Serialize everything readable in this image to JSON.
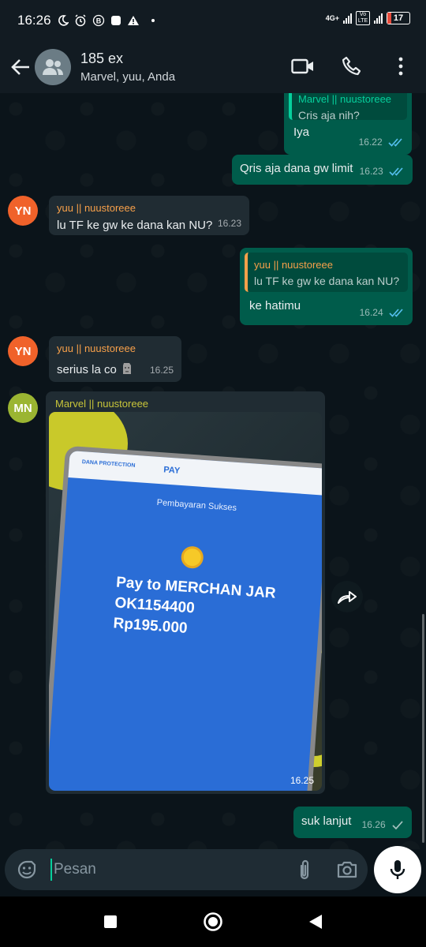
{
  "status_bar": {
    "time": "16:26",
    "network": "4G+",
    "volte": "Vo LTE",
    "battery": "17"
  },
  "header": {
    "title": "185 ex",
    "subtitle": "Marvel, yuu, Anda"
  },
  "messages": [
    {
      "type": "out",
      "quote_name": "Marvel || nuustoreee",
      "quote_text": "Cris aja nih?",
      "text": "Iya",
      "time": "16.22",
      "status": "read"
    },
    {
      "type": "out",
      "text": "Qris aja dana gw limit",
      "time": "16.23",
      "status": "read"
    },
    {
      "type": "in",
      "avatar": "YN",
      "sender": "yuu || nuustoreee",
      "text": "lu TF ke gw ke dana kan NU?",
      "time": "16.23"
    },
    {
      "type": "out",
      "quote_name": "yuu || nuustoreee",
      "quote_text": "lu TF ke gw ke dana kan NU?",
      "text": "ke hatimu",
      "time": "16.24",
      "status": "read"
    },
    {
      "type": "in",
      "avatar": "YN",
      "sender": "yuu || nuustoreee",
      "text": "serius la co",
      "emoji": "moai",
      "time": "16.25"
    },
    {
      "type": "in-image",
      "avatar": "MN",
      "sender": "Marvel || nuustoreee",
      "time": "16.25",
      "image_text": {
        "brand": "DANA PROTECTION",
        "app": "PAY",
        "heading": "Pembayaran Sukses",
        "line1": "Pay to MERCHAN JAR",
        "line2": "OK1154400",
        "line3": "Rp195.000"
      }
    },
    {
      "type": "out",
      "text": "suk lanjut",
      "time": "16.26",
      "status": "sent"
    }
  ],
  "input": {
    "placeholder": "Pesan"
  },
  "colors": {
    "outgoing_bubble": "#005c4b",
    "incoming_bubble": "#202c33",
    "yn_avatar": "#f0622a",
    "mn_avatar": "#9bb532",
    "yuu_name": "#f7a04a",
    "marvel_name": "#c8c53a",
    "read_tick": "#53bdeb"
  },
  "icons": [
    "back-arrow-icon",
    "group-avatar-icon",
    "video-call-icon",
    "phone-call-icon",
    "more-options-icon",
    "forward-icon",
    "sticker-icon",
    "attach-icon",
    "camera-icon",
    "mic-icon",
    "nav-square-icon",
    "nav-circle-icon",
    "nav-back-icon"
  ]
}
